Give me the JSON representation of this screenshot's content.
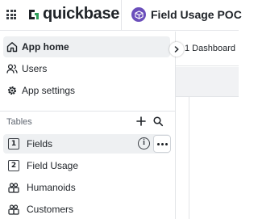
{
  "header": {
    "brand": "quickbase",
    "app_title": "Field Usage POC",
    "icons": {
      "apps": "apps-grid-icon",
      "logo": "quickbase-logo-icon",
      "app": "app-icon"
    },
    "colors": {
      "app_icon_bg": "#6b4fbb",
      "logo_green": "#2f9e5a",
      "logo_dark": "#1f2328"
    }
  },
  "content": {
    "dashboard_label": "1 Dashboard"
  },
  "sidebar": {
    "nav_items": [
      {
        "label": "App home",
        "icon": "home-icon",
        "active": true
      },
      {
        "label": "Users",
        "icon": "users-icon",
        "active": false
      },
      {
        "label": "App settings",
        "icon": "gear-icon",
        "active": false
      }
    ],
    "tables_section": {
      "label": "Tables",
      "add_icon": "plus-icon",
      "search_icon": "search-icon"
    },
    "tables": [
      {
        "label": "Fields",
        "icon_glyph": "1",
        "active": true
      },
      {
        "label": "Field Usage",
        "icon_glyph": "2",
        "active": false
      },
      {
        "label": "Humanoids",
        "icon_glyph": "people",
        "active": false
      },
      {
        "label": "Customers",
        "icon_glyph": "people",
        "active": false
      }
    ],
    "row_actions": {
      "info_glyph": "i",
      "more": "more-icon"
    }
  }
}
